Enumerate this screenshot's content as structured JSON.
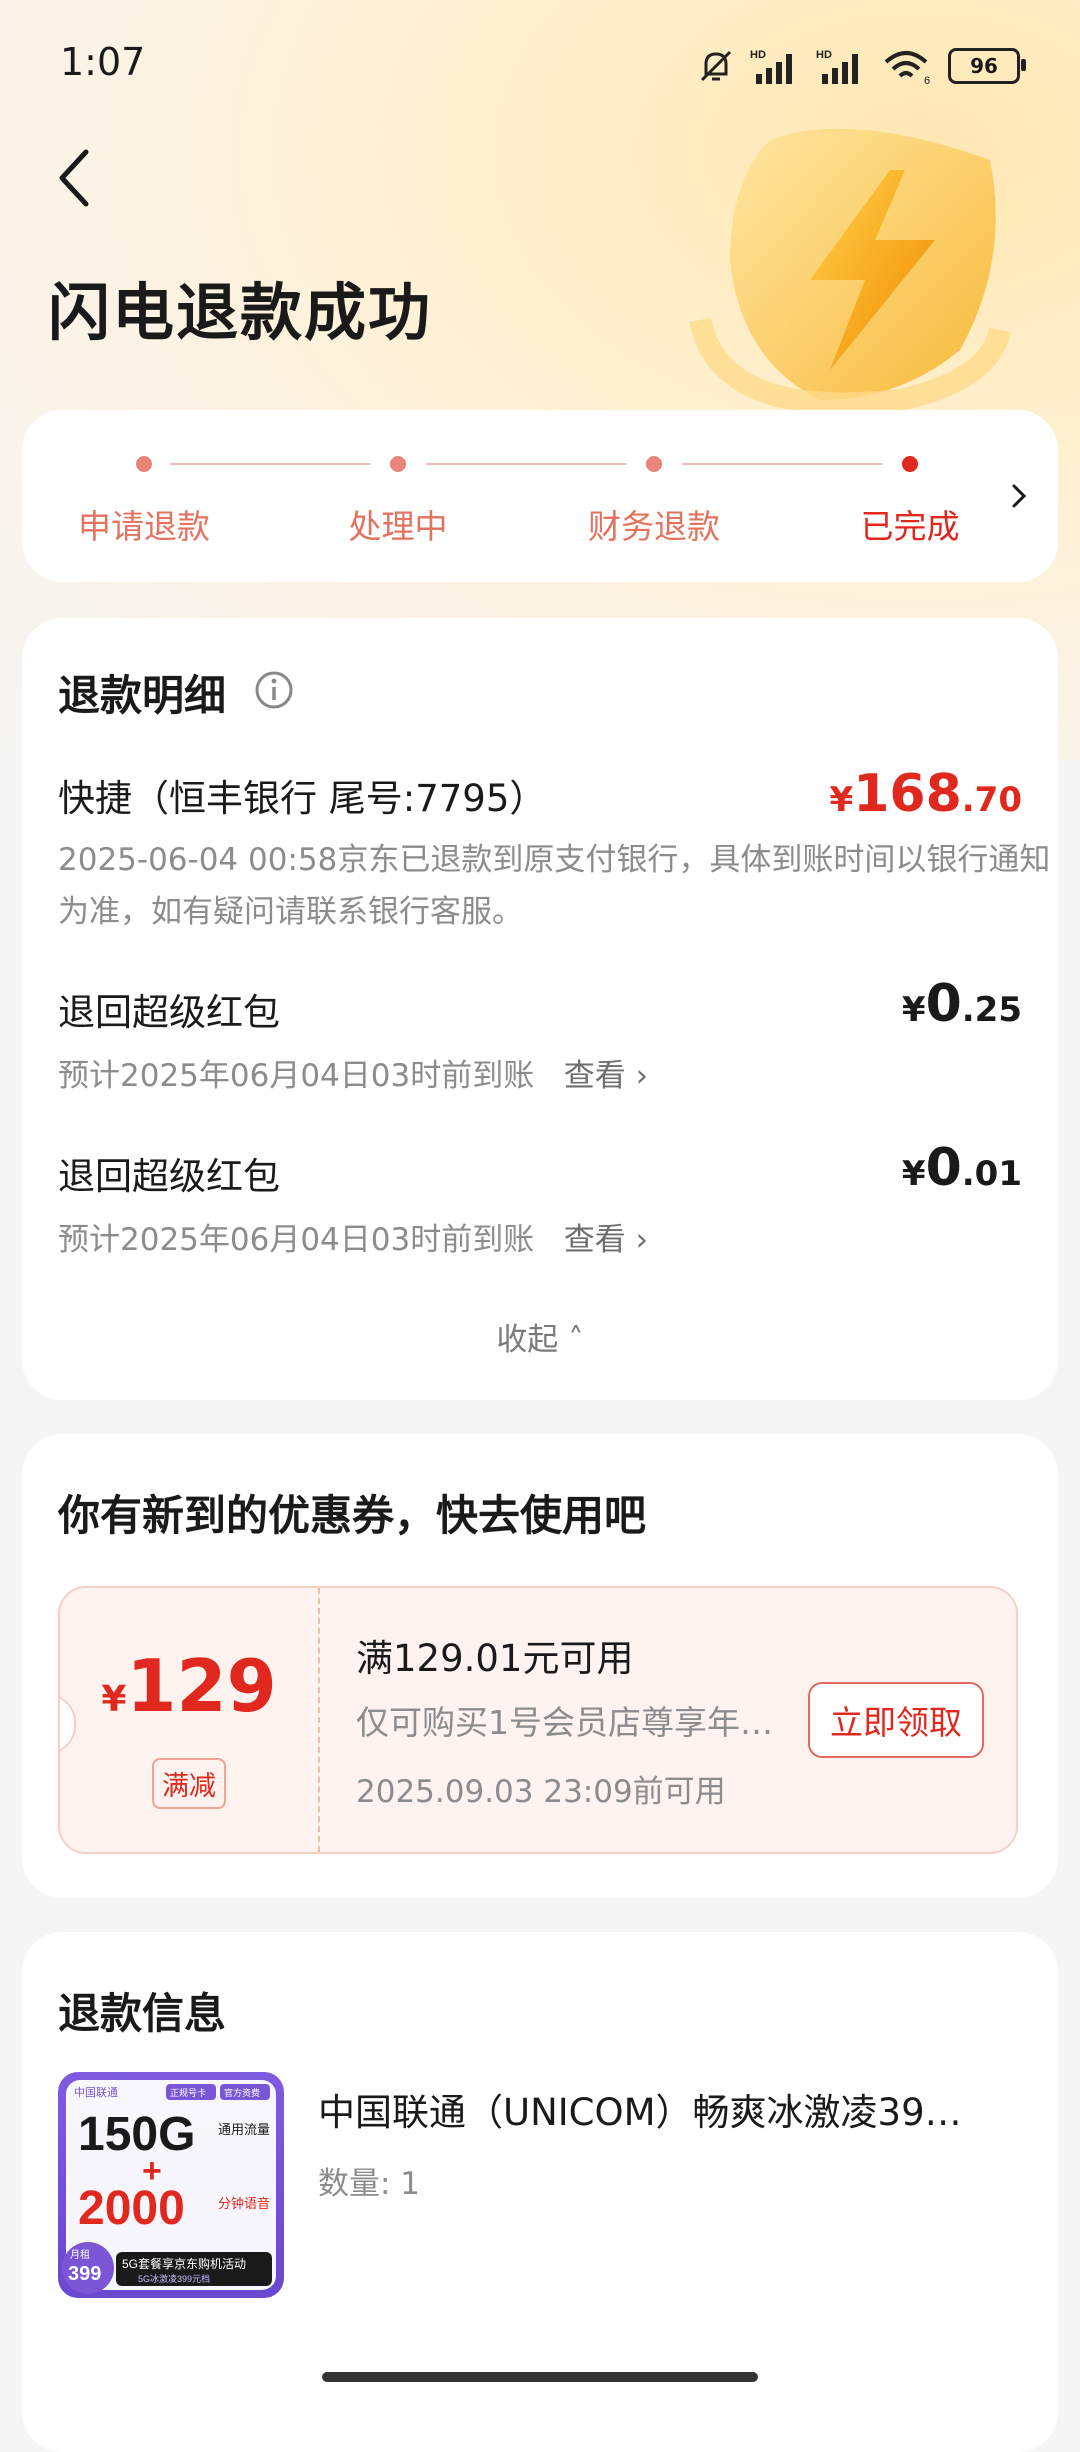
{
  "status_bar": {
    "time": "1:07",
    "battery": "96",
    "signal1_label": "HD",
    "signal2_label": "HD",
    "wifi_badge": "6"
  },
  "header": {
    "title": "闪电退款成功"
  },
  "progress": {
    "steps": [
      {
        "label": "申请退款"
      },
      {
        "label": "处理中"
      },
      {
        "label": "财务退款"
      },
      {
        "label": "已完成"
      }
    ]
  },
  "refund_detail": {
    "title": "退款明细",
    "items": [
      {
        "title": "快捷（恒丰银行 尾号:7795）",
        "currency": "¥",
        "amount_int": "168",
        "amount_dec": ".70",
        "desc": "2025-06-04 00:58京东已退款到原支付银行，具体到账时间以银行通知为准，如有疑问请联系银行客服。"
      },
      {
        "title": "退回超级红包",
        "currency": "¥",
        "amount_int": "0",
        "amount_dec": ".25",
        "desc": "预计2025年06月04日03时前到账",
        "link": "查看 ›"
      },
      {
        "title": "退回超级红包",
        "currency": "¥",
        "amount_int": "0",
        "amount_dec": ".01",
        "desc": "预计2025年06月04日03时前到账",
        "link": "查看 ›"
      }
    ],
    "collapse": "收起 ˄"
  },
  "coupon_section": {
    "title": "你有新到的优惠券，快去使用吧",
    "coupon": {
      "currency": "¥",
      "value": "129",
      "tag": "满减",
      "condition": "满129.01元可用",
      "desc": "仅可购买1号会员店尊享年…",
      "expire": "2025.09.03 23:09前可用",
      "button": "立即领取"
    }
  },
  "refund_info": {
    "title": "退款信息",
    "product": {
      "name": "中国联通（UNICOM）畅爽冰激凌39…",
      "qty": "数量: 1",
      "image_text": {
        "brand": "中国联通",
        "badge1": "正规号卡",
        "badge2": "官方资费",
        "data": "150G",
        "data_unit": "通用流量",
        "plus": "+",
        "voice": "2000",
        "voice_unit": "分钟语音",
        "price_small": "月租",
        "price": "399",
        "promo": "5G套餐享京东购机活动",
        "promo_sub": "5G冰激凌399元档"
      }
    }
  },
  "colors": {
    "accent": "#e0281e",
    "progress": "#e8847a",
    "coupon_bg": "#fff3ef"
  }
}
